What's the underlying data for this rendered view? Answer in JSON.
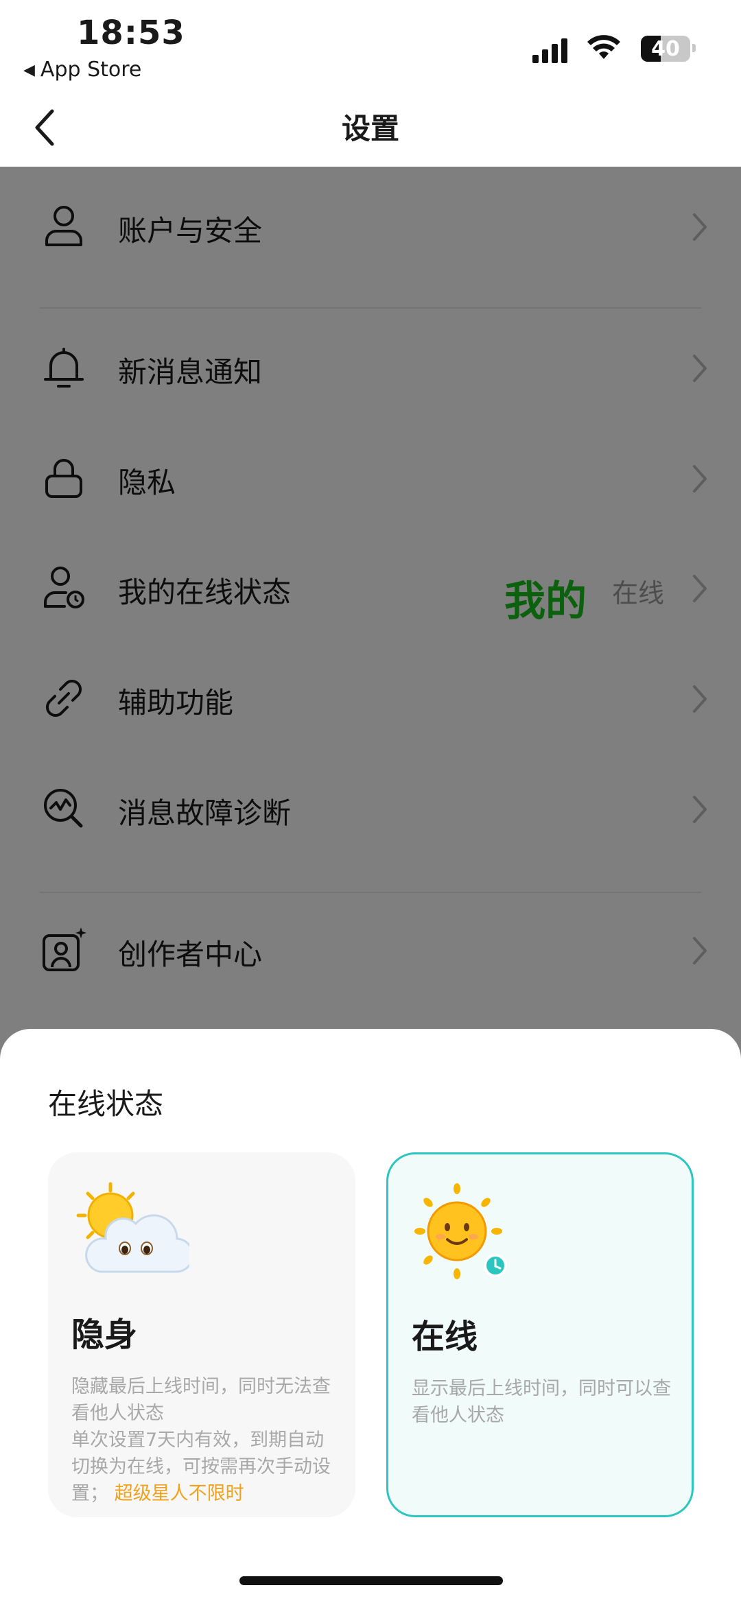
{
  "status_bar": {
    "time": "18:53",
    "back_app": "App Store",
    "battery_level": "40"
  },
  "nav": {
    "title": "设置"
  },
  "settings": {
    "items": [
      {
        "label": "账户与安全",
        "icon": "user-icon"
      },
      {
        "label": "新消息通知",
        "icon": "bell-icon"
      },
      {
        "label": "隐私",
        "icon": "lock-icon"
      },
      {
        "label": "我的在线状态",
        "icon": "user-status-icon",
        "value": "在线",
        "note": "我的"
      },
      {
        "label": "辅助功能",
        "icon": "link-icon"
      },
      {
        "label": "消息故障诊断",
        "icon": "diagnosis-icon"
      },
      {
        "label": "创作者中心",
        "icon": "creator-icon"
      }
    ]
  },
  "sheet": {
    "title": "在线状态",
    "options": [
      {
        "title": "隐身",
        "icon": "sun-behind-cloud-icon",
        "desc_line1": "隐藏最后上线时间，同时无法查看他人状态",
        "desc_line2": "单次设置7天内有效，到期自动切换为在线，可按需再次手动设置；",
        "promo": "超级星人不限时",
        "selected": false
      },
      {
        "title": "在线",
        "icon": "sun-face-icon",
        "desc_line1": "显示最后上线时间，同时可以查看他人状态",
        "selected": true
      }
    ]
  },
  "colors": {
    "accent_teal": "#2cc6c0",
    "promo_orange": "#f0a21e",
    "annotation_green": "#19c21c"
  }
}
